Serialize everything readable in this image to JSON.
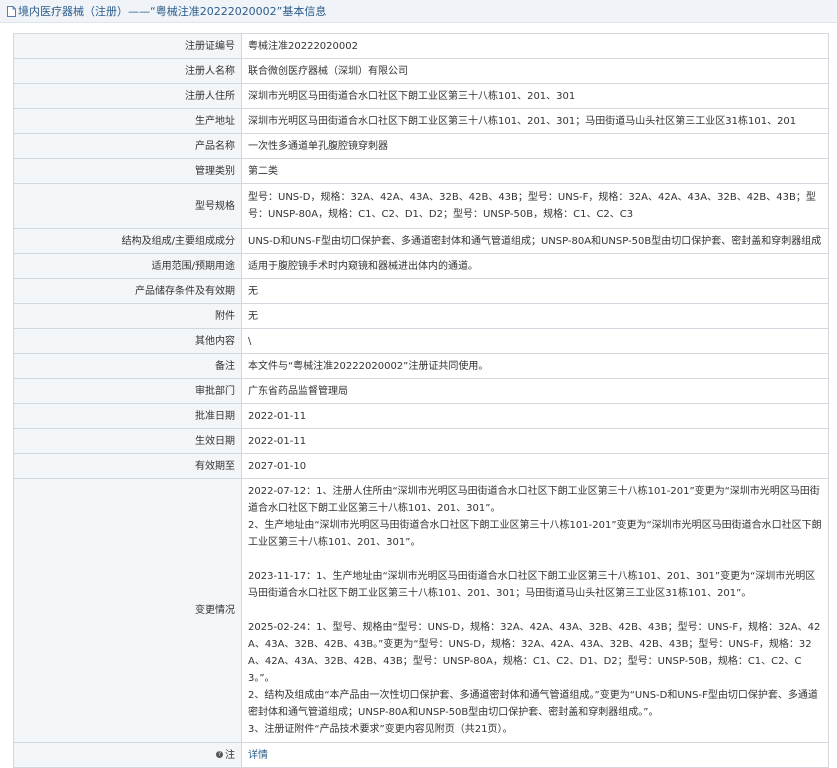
{
  "header": {
    "title": "境内医疗器械（注册）——“粤械注准20222020002”基本信息"
  },
  "rows": [
    {
      "label": "注册证编号",
      "value": "粤械注准20222020002"
    },
    {
      "label": "注册人名称",
      "value": "联合微创医疗器械（深圳）有限公司"
    },
    {
      "label": "注册人住所",
      "value": "深圳市光明区马田街道合水口社区下朗工业区第三十八栋101、201、301"
    },
    {
      "label": "生产地址",
      "value": "深圳市光明区马田街道合水口社区下朗工业区第三十八栋101、201、301；马田街道马山头社区第三工业区31栋101、201"
    },
    {
      "label": "产品名称",
      "value": "一次性多通道单孔腹腔镜穿刺器"
    },
    {
      "label": "管理类别",
      "value": "第二类"
    },
    {
      "label": "型号规格",
      "value": "型号：UNS-D，规格：32A、42A、43A、32B、42B、43B；型号：UNS-F，规格：32A、42A、43A、32B、42B、43B；型号：UNSP-80A，规格：C1、C2、D1、D2；型号：UNSP-50B，规格：C1、C2、C3"
    },
    {
      "label": "结构及组成/主要组成成分",
      "value": "UNS-D和UNS-F型由切口保护套、多通道密封体和通气管道组成；UNSP-80A和UNSP-50B型由切口保护套、密封盖和穿刺器组成"
    },
    {
      "label": "适用范围/预期用途",
      "value": "适用于腹腔镜手术时内窥镜和器械进出体内的通道。"
    },
    {
      "label": "产品储存条件及有效期",
      "value": "无"
    },
    {
      "label": "附件",
      "value": "无"
    },
    {
      "label": "其他内容",
      "value": "\\"
    },
    {
      "label": "备注",
      "value": "本文件与“粤械注准20222020002”注册证共同使用。"
    },
    {
      "label": "审批部门",
      "value": "广东省药品监督管理局"
    },
    {
      "label": "批准日期",
      "value": "2022-01-11"
    },
    {
      "label": "生效日期",
      "value": "2022-01-11"
    },
    {
      "label": "有效期至",
      "value": "2027-01-10"
    }
  ],
  "changes": {
    "label": "变更情况",
    "block1": [
      "2022-07-12：1、注册人住所由“深圳市光明区马田街道合水口社区下朗工业区第三十八栋101-201”变更为“深圳市光明区马田街道合水口社区下朗工业区第三十八栋101、201、301”。",
      "2、生产地址由“深圳市光明区马田街道合水口社区下朗工业区第三十八栋101-201”变更为“深圳市光明区马田街道合水口社区下朗工业区第三十八栋101、201、301”。"
    ],
    "block2": [
      "2023-11-17：1、生产地址由“深圳市光明区马田街道合水口社区下朗工业区第三十八栋101、201、301”变更为“深圳市光明区马田街道合水口社区下朗工业区第三十八栋101、201、301；马田街道马山头社区第三工业区31栋101、201”。"
    ],
    "block3": [
      "2025-02-24：1、型号、规格由“型号：UNS-D，规格：32A、42A、43A、32B、42B、43B；型号：UNS-F，规格：32A、42A、43A、32B、42B、43B。”变更为“型号：UNS-D，规格：32A、42A、43A、32B、42B、43B；型号：UNS-F，规格：32A、42A、43A、32B、42B、43B；型号：UNSP-80A，规格：C1、C2、D1、D2；型号：UNSP-50B，规格：C1、C2、C3。”。",
      "2、结构及组成由“本产品由一次性切口保护套、多通道密封体和通气管道组成。”变更为“UNS-D和UNS-F型由切口保护套、多通道密封体和通气管道组成；UNSP-80A和UNSP-50B型由切口保护套、密封盖和穿刺器组成。”。",
      "3、注册证附件“产品技术要求”变更内容见附页（共21页）。"
    ]
  },
  "note": {
    "label": "注",
    "link": "详情"
  },
  "icons": {
    "header": "document-icon",
    "note": "question-circle-icon"
  },
  "colors": {
    "link": "#2c5c8a",
    "label_bg": "#f3f6f9",
    "header_bg": "#f0f4f8",
    "border": "#d2d8de"
  }
}
